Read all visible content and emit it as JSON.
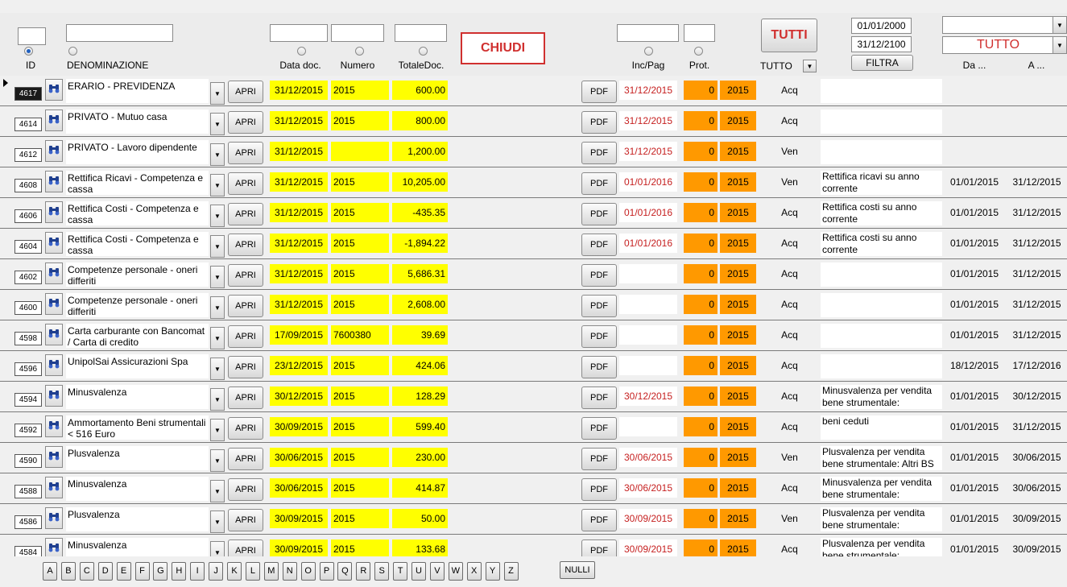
{
  "header": {
    "labels": {
      "id": "ID",
      "denominazione": "DENOMINAZIONE",
      "data_doc": "Data doc.",
      "numero": "Numero",
      "totale_doc": "TotaleDoc.",
      "inc_pag": "Inc/Pag",
      "prot": "Prot.",
      "tutto_small": "TUTTO",
      "da": "Da ...",
      "a": "A ..."
    },
    "chiudi_label": "CHIUDI",
    "tutti_label": "TUTTI",
    "date_from": "01/01/2000",
    "date_to": "31/12/2100",
    "filtra_label": "FILTRA",
    "combo_value": "TUTTO"
  },
  "rows": [
    {
      "id": "4617",
      "name": "ERARIO - PREVIDENZA",
      "apri": "APRI",
      "data_doc": "31/12/2015",
      "numero": "2015",
      "totale": "600.00",
      "pdf": "PDF",
      "inc_pag": "31/12/2015",
      "prot": "0",
      "anno": "2015",
      "tipo": "Acq",
      "note": "",
      "da": "",
      "a": ""
    },
    {
      "id": "4614",
      "name": "PRIVATO - Mutuo casa",
      "apri": "APRI",
      "data_doc": "31/12/2015",
      "numero": "2015",
      "totale": "800.00",
      "pdf": "PDF",
      "inc_pag": "31/12/2015",
      "prot": "0",
      "anno": "2015",
      "tipo": "Acq",
      "note": "",
      "da": "",
      "a": ""
    },
    {
      "id": "4612",
      "name": "PRIVATO - Lavoro dipendente",
      "apri": "APRI",
      "data_doc": "31/12/2015",
      "numero": "",
      "totale": "1,200.00",
      "pdf": "PDF",
      "inc_pag": "31/12/2015",
      "prot": "0",
      "anno": "2015",
      "tipo": "Ven",
      "note": "",
      "da": "",
      "a": ""
    },
    {
      "id": "4608",
      "name": "Rettifica Ricavi - Competenza e cassa",
      "apri": "APRI",
      "data_doc": "31/12/2015",
      "numero": "2015",
      "totale": "10,205.00",
      "pdf": "PDF",
      "inc_pag": "01/01/2016",
      "prot": "0",
      "anno": "2015",
      "tipo": "Ven",
      "note": "Rettifica ricavi su anno corrente",
      "da": "01/01/2015",
      "a": "31/12/2015"
    },
    {
      "id": "4606",
      "name": "Rettifica Costi - Competenza e cassa",
      "apri": "APRI",
      "data_doc": "31/12/2015",
      "numero": "2015",
      "totale": "-435.35",
      "pdf": "PDF",
      "inc_pag": "01/01/2016",
      "prot": "0",
      "anno": "2015",
      "tipo": "Acq",
      "note": "Rettifica costi su anno corrente",
      "da": "01/01/2015",
      "a": "31/12/2015"
    },
    {
      "id": "4604",
      "name": "Rettifica Costi - Competenza e cassa",
      "apri": "APRI",
      "data_doc": "31/12/2015",
      "numero": "2015",
      "totale": "-1,894.22",
      "pdf": "PDF",
      "inc_pag": "01/01/2016",
      "prot": "0",
      "anno": "2015",
      "tipo": "Acq",
      "note": "Rettifica costi su anno corrente",
      "da": "01/01/2015",
      "a": "31/12/2015"
    },
    {
      "id": "4602",
      "name": "Competenze personale - oneri differiti",
      "apri": "APRI",
      "data_doc": "31/12/2015",
      "numero": "2015",
      "totale": "5,686.31",
      "pdf": "PDF",
      "inc_pag": "",
      "prot": "0",
      "anno": "2015",
      "tipo": "Acq",
      "note": "",
      "da": "01/01/2015",
      "a": "31/12/2015"
    },
    {
      "id": "4600",
      "name": "Competenze personale - oneri differiti",
      "apri": "APRI",
      "data_doc": "31/12/2015",
      "numero": "2015",
      "totale": "2,608.00",
      "pdf": "PDF",
      "inc_pag": "",
      "prot": "0",
      "anno": "2015",
      "tipo": "Acq",
      "note": "",
      "da": "01/01/2015",
      "a": "31/12/2015"
    },
    {
      "id": "4598",
      "name": "Carta carburante con Bancomat / Carta di credito",
      "apri": "APRI",
      "data_doc": "17/09/2015",
      "numero": "7600380",
      "totale": "39.69",
      "pdf": "PDF",
      "inc_pag": "",
      "prot": "0",
      "anno": "2015",
      "tipo": "Acq",
      "note": "",
      "da": "01/01/2015",
      "a": "31/12/2015"
    },
    {
      "id": "4596",
      "name": "UnipolSai Assicurazioni Spa",
      "apri": "APRI",
      "data_doc": "23/12/2015",
      "numero": "2015",
      "totale": "424.06",
      "pdf": "PDF",
      "inc_pag": "",
      "prot": "0",
      "anno": "2015",
      "tipo": "Acq",
      "note": "",
      "da": "18/12/2015",
      "a": "17/12/2016"
    },
    {
      "id": "4594",
      "name": "Minusvalenza",
      "apri": "APRI",
      "data_doc": "30/12/2015",
      "numero": "2015",
      "totale": "128.29",
      "pdf": "PDF",
      "inc_pag": "30/12/2015",
      "prot": "0",
      "anno": "2015",
      "tipo": "Acq",
      "note": "Minusvalenza per vendita bene strumentale:",
      "da": "01/01/2015",
      "a": "30/12/2015"
    },
    {
      "id": "4592",
      "name": "Ammortamento Beni strumentali < 516 Euro",
      "apri": "APRI",
      "data_doc": "30/09/2015",
      "numero": "2015",
      "totale": "599.40",
      "pdf": "PDF",
      "inc_pag": "",
      "prot": "0",
      "anno": "2015",
      "tipo": "Acq",
      "note": "beni ceduti",
      "da": "01/01/2015",
      "a": "31/12/2015"
    },
    {
      "id": "4590",
      "name": "Plusvalenza",
      "apri": "APRI",
      "data_doc": "30/06/2015",
      "numero": "2015",
      "totale": "230.00",
      "pdf": "PDF",
      "inc_pag": "30/06/2015",
      "prot": "0",
      "anno": "2015",
      "tipo": "Ven",
      "note": "Plusvalenza per vendita bene strumentale: Altri BS",
      "da": "01/01/2015",
      "a": "30/06/2015"
    },
    {
      "id": "4588",
      "name": "Minusvalenza",
      "apri": "APRI",
      "data_doc": "30/06/2015",
      "numero": "2015",
      "totale": "414.87",
      "pdf": "PDF",
      "inc_pag": "30/06/2015",
      "prot": "0",
      "anno": "2015",
      "tipo": "Acq",
      "note": "Minusvalenza per vendita bene strumentale:",
      "da": "01/01/2015",
      "a": "30/06/2015"
    },
    {
      "id": "4586",
      "name": "Plusvalenza",
      "apri": "APRI",
      "data_doc": "30/09/2015",
      "numero": "2015",
      "totale": "50.00",
      "pdf": "PDF",
      "inc_pag": "30/09/2015",
      "prot": "0",
      "anno": "2015",
      "tipo": "Ven",
      "note": "Plusvalenza per vendita bene strumentale:",
      "da": "01/01/2015",
      "a": "30/09/2015"
    },
    {
      "id": "4584",
      "name": "Minusvalenza",
      "apri": "APRI",
      "data_doc": "30/09/2015",
      "numero": "2015",
      "totale": "133.68",
      "pdf": "PDF",
      "inc_pag": "30/09/2015",
      "prot": "0",
      "anno": "2015",
      "tipo": "Acq",
      "note": "Plusvalenza per vendita bene strumentale:",
      "da": "01/01/2015",
      "a": "30/09/2015"
    }
  ],
  "alphabet": [
    "A",
    "B",
    "C",
    "D",
    "E",
    "F",
    "G",
    "H",
    "I",
    "J",
    "K",
    "L",
    "M",
    "N",
    "O",
    "P",
    "Q",
    "R",
    "S",
    "T",
    "U",
    "V",
    "W",
    "X",
    "Y",
    "Z"
  ],
  "nulli_label": "NULLI"
}
